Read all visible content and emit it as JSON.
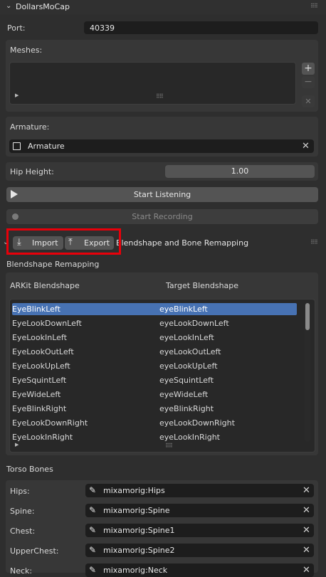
{
  "header": {
    "title": "DollarsMoCap"
  },
  "port": {
    "label": "Port:",
    "value": "40339"
  },
  "meshes": {
    "label": "Meshes:",
    "add": "+",
    "remove": "−",
    "close": "✕"
  },
  "armature": {
    "label": "Armature:",
    "value": "Armature"
  },
  "hip_height": {
    "label": "Hip Height:",
    "value": "1.00"
  },
  "actions": {
    "start_listening": "Start Listening",
    "start_recording": "Start Recording"
  },
  "remap": {
    "import_label": "Import",
    "export_label": "Export",
    "section_title": "Blendshape and Bone Remapping",
    "subsection": "Blendshape Remapping",
    "col_source": "ARKit Blendshape",
    "col_target": "Target Blendshape",
    "rows": [
      {
        "src": "EyeBlinkLeft",
        "dst": "eyeBlinkLeft"
      },
      {
        "src": "EyeLookDownLeft",
        "dst": "eyeLookDownLeft"
      },
      {
        "src": "EyeLookInLeft",
        "dst": "eyeLookInLeft"
      },
      {
        "src": "EyeLookOutLeft",
        "dst": "eyeLookOutLeft"
      },
      {
        "src": "EyeLookUpLeft",
        "dst": "eyeLookUpLeft"
      },
      {
        "src": "EyeSquintLeft",
        "dst": "eyeSquintLeft"
      },
      {
        "src": "EyeWideLeft",
        "dst": "eyeWideLeft"
      },
      {
        "src": "EyeBlinkRight",
        "dst": "eyeBlinkRight"
      },
      {
        "src": "EyeLookDownRight",
        "dst": "eyeLookDownRight"
      },
      {
        "src": "EyeLookInRight",
        "dst": "eyeLookInRight"
      }
    ]
  },
  "torso": {
    "label": "Torso Bones",
    "bones": [
      {
        "label": "Hips:",
        "value": "mixamorig:Hips"
      },
      {
        "label": "Spine:",
        "value": "mixamorig:Spine"
      },
      {
        "label": "Chest:",
        "value": "mixamorig:Spine1"
      },
      {
        "label": "UpperChest:",
        "value": "mixamorig:Spine2"
      },
      {
        "label": "Neck:",
        "value": "mixamorig:Neck"
      }
    ]
  },
  "colors": {
    "highlight": "#e8000a",
    "selected_row": "#4772b3",
    "panel": "#373737",
    "field": "#1d1d1d"
  }
}
